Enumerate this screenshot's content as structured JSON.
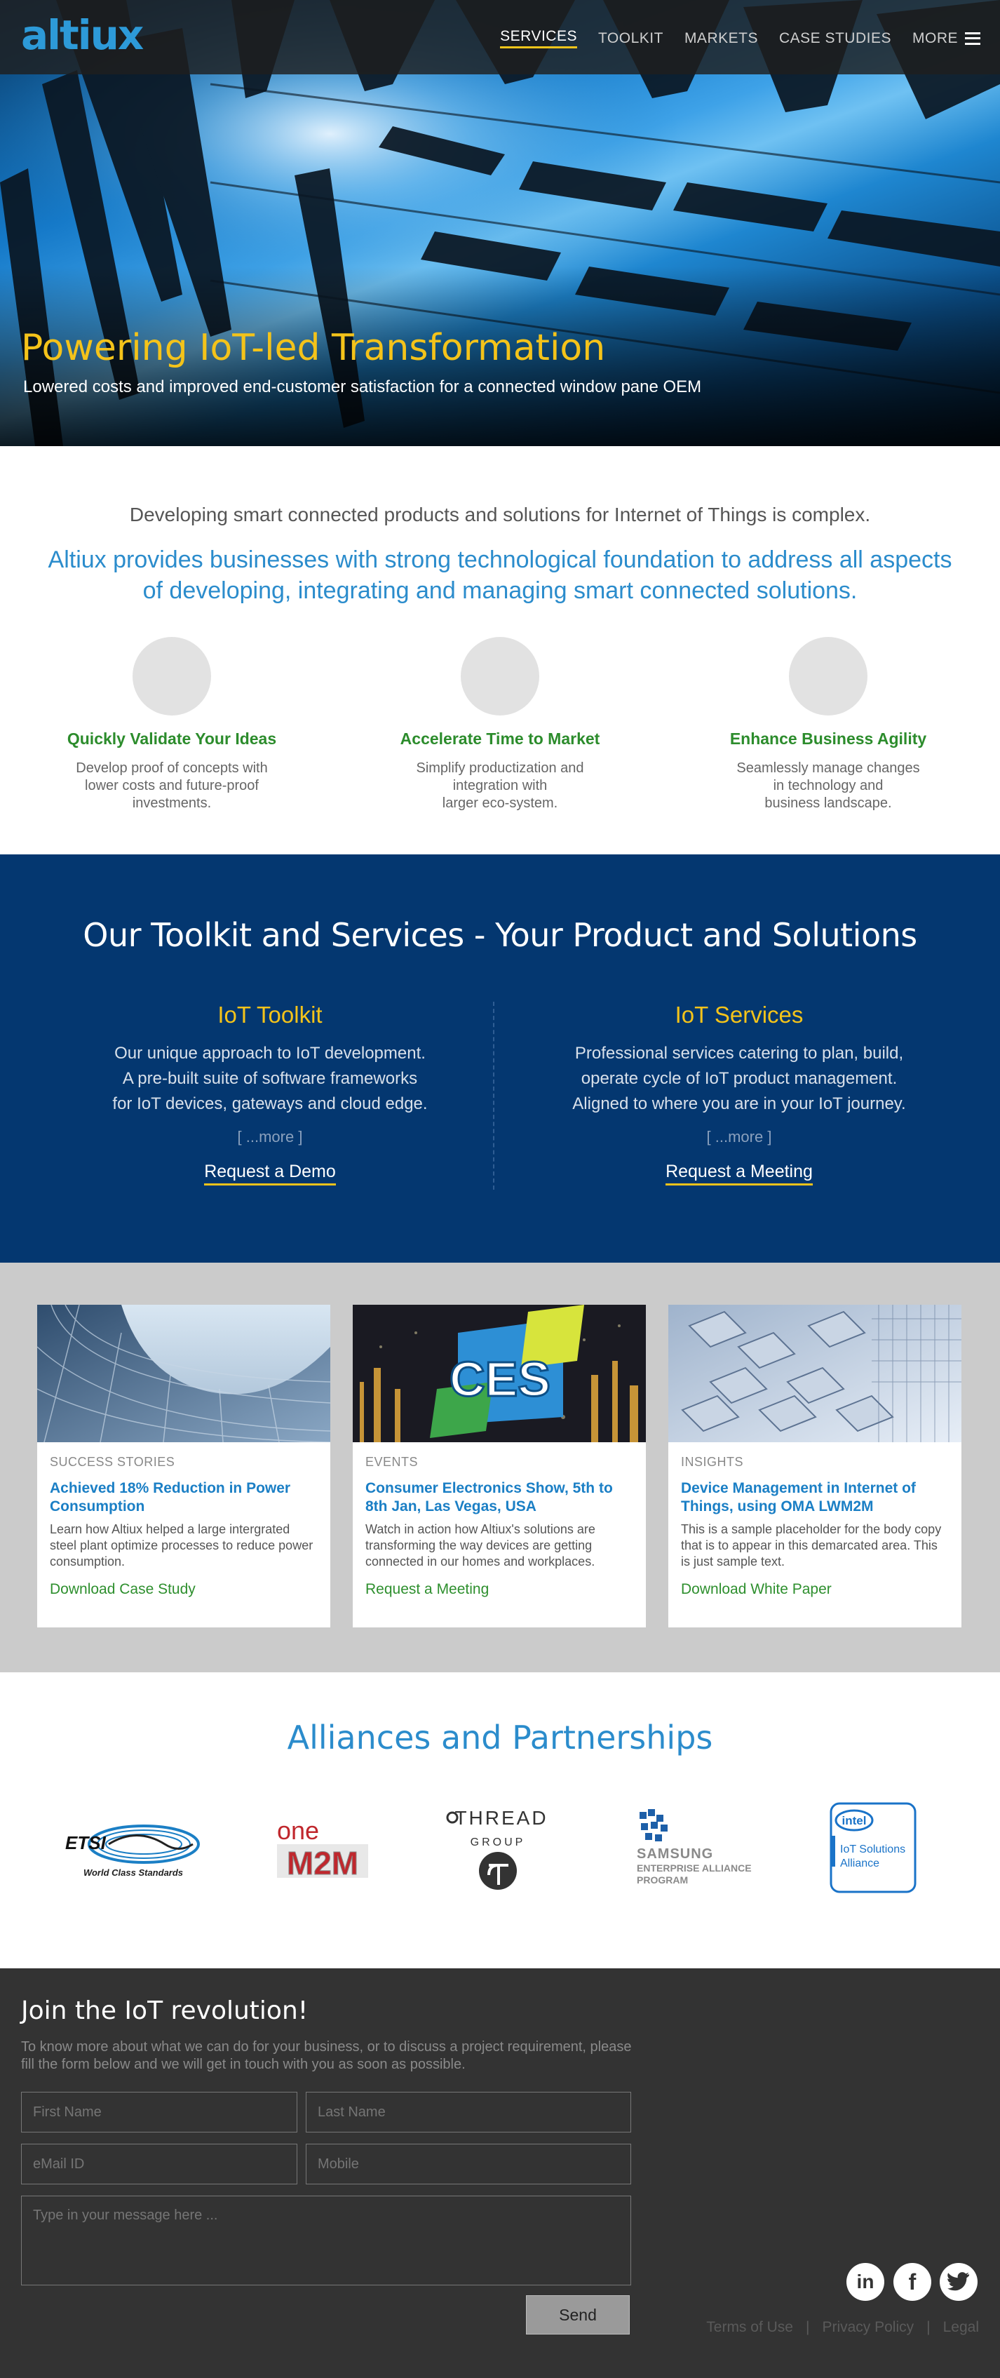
{
  "header": {
    "logo": "altiux",
    "nav": [
      {
        "label": "SERVICES",
        "active": true
      },
      {
        "label": "TOOLKIT",
        "active": false
      },
      {
        "label": "MARKETS",
        "active": false
      },
      {
        "label": "CASE STUDIES",
        "active": false
      },
      {
        "label": "MORE",
        "active": false
      }
    ],
    "menu_icon": "hamburger-menu-icon"
  },
  "hero": {
    "title": "Powering IoT-led Transformation",
    "subtitle": "Lowered costs and improved end-customer satisfaction for a connected window pane OEM"
  },
  "intro": {
    "lead": "Developing smart connected products and solutions for Internet of Things is complex.",
    "strong": "Altiux provides businesses with strong technological foundation to address all aspects of developing, integrating and managing smart connected solutions.",
    "features": [
      {
        "title": "Quickly Validate Your Ideas",
        "text": "Develop proof of concepts with\nlower costs and future-proof\ninvestments."
      },
      {
        "title": "Accelerate Time to Market",
        "text": "Simplify productization and\nintegration with\nlarger eco-system."
      },
      {
        "title": "Enhance Business Agility",
        "text": "Seamlessly manage changes\nin technology and\nbusiness landscape."
      }
    ]
  },
  "toolkit": {
    "heading": "Our Toolkit and Services - Your Product and Solutions",
    "columns": [
      {
        "title": "IoT Toolkit",
        "text": "Our unique approach to IoT development.\nA pre-built suite of software frameworks\nfor IoT devices, gateways and cloud edge.",
        "more": "[ ...more ]",
        "cta": "Request a Demo"
      },
      {
        "title": "IoT Services",
        "text": "Professional services catering to plan, build,\noperate cycle of IoT product management.\nAligned to where you are in your IoT journey.",
        "more": "[ ...more ]",
        "cta": "Request a Meeting"
      }
    ]
  },
  "cards": [
    {
      "category": "SUCCESS STORIES",
      "title": "Achieved 18% Reduction in Power Consumption",
      "desc": "Learn how Altiux helped a large intergrated steel plant optimize processes to reduce power consumption.",
      "link": "Download Case Study"
    },
    {
      "category": "EVENTS",
      "title": "Consumer Electronics Show, 5th to 8th Jan, Las Vegas, USA",
      "desc": "Watch in action how Altiux's solutions are transforming the way devices are getting connected in our homes and workplaces.",
      "link": "Request a Meeting",
      "badge": "CES"
    },
    {
      "category": "INSIGHTS",
      "title": "Device Management in Internet of Things, using OMA LWM2M",
      "desc": "This is a sample placeholder for the body copy that is to appear in this demarcated area. This is just sample text.",
      "link": "Download White Paper"
    }
  ],
  "alliances": {
    "heading": "Alliances and Partnerships",
    "logos": {
      "etsi": {
        "name": "ETSI",
        "tagline": "World Class Standards"
      },
      "onem2m": {
        "line1": "one",
        "line2": "M2M"
      },
      "thread": {
        "name": "THREAD",
        "sub": "GROUP"
      },
      "samsung": {
        "line1": "SAMSUNG",
        "line2": "ENTERPRISE ALLIANCE",
        "line3": "PROGRAM"
      },
      "intel": {
        "brand": "intel",
        "line1": "IoT Solutions",
        "line2": "Alliance"
      }
    }
  },
  "footer": {
    "heading": "Join the IoT revolution!",
    "lead": "To know more about what we can do for your business, or to discuss a project requirement, please fill the form below and we will get in touch with you as soon as possible.",
    "form": {
      "first_name": "First Name",
      "last_name": "Last Name",
      "email": "eMail ID",
      "mobile": "Mobile",
      "message": "Type in your message here ...",
      "send": "Send"
    },
    "social": {
      "linkedin": "in",
      "facebook": "f"
    },
    "legal": [
      "Terms of Use",
      "Privacy Policy",
      "Legal"
    ],
    "separator": "|"
  },
  "colors": {
    "accent_blue": "#2b8ccc",
    "yellow": "#f4c31a",
    "green": "#2c8c2c",
    "navy": "#043770",
    "footer_bg": "#333333"
  }
}
